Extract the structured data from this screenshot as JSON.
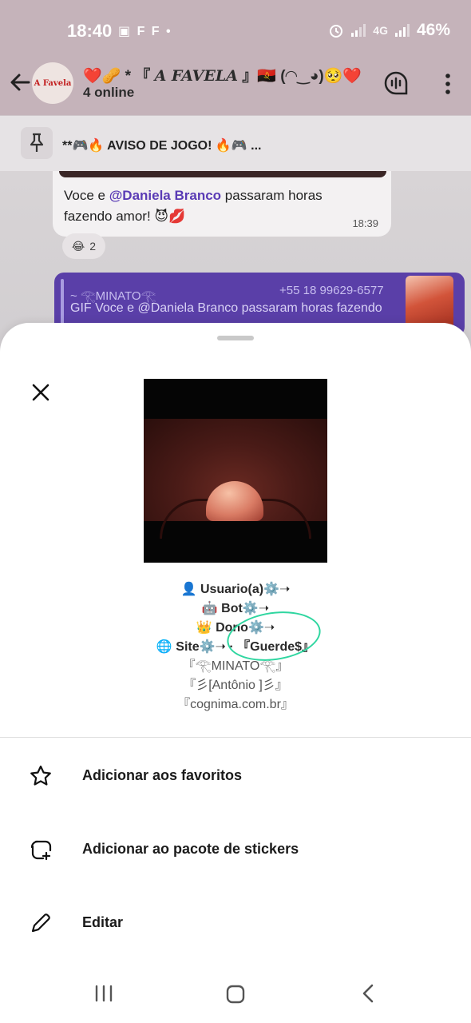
{
  "status_bar": {
    "time": "18:40",
    "left_icons": "▣ F F •",
    "network": "4G",
    "battery": "46%"
  },
  "header": {
    "avatar_text": "A Favela",
    "title_prefix": "❤️🥜 * 『",
    "title_name": "A FAVELA",
    "title_suffix": "』🇦🇴 (◠‿◕)🥺❤️",
    "subtitle": "4 online"
  },
  "pinned": {
    "text": "**🎮🔥 AVISO DE JOGO! 🔥🎮  ..."
  },
  "message": {
    "text_before": "Voce e ",
    "mention": "@Daniela Branco",
    "text_after": " passaram horas fazendo amor! 😈💋",
    "time": "18:39",
    "reaction_emoji": "😂",
    "reaction_count": "2"
  },
  "reply": {
    "name": "~ 𓂀MINATO𓂀",
    "phone": "+55 18 99629-6577",
    "text": "GIF Voce e @Daniela Branco passaram horas fazendo"
  },
  "sticker_sheet": {
    "info_lines": [
      "👤 Usuario(a)⚙️➝",
      "🤖 Bot⚙️➝",
      "👑 Dono⚙️➝",
      "🌐 Site⚙️➝ · 『Guerde$』",
      "『𓂀MINATO𓂀』",
      "『彡[Antônio ]彡』",
      "『cognima.com.br』"
    ]
  },
  "actions": [
    {
      "label": "Adicionar aos favoritos",
      "icon": "star-icon"
    },
    {
      "label": "Adicionar ao pacote de stickers",
      "icon": "sticker-add-icon"
    },
    {
      "label": "Editar",
      "icon": "pencil-icon"
    }
  ],
  "colors": {
    "header_bg": "#c5b3ba",
    "mention": "#5a3bb5",
    "reply_bubble": "#5a3fa8",
    "highlight": "#2fd6a0"
  }
}
